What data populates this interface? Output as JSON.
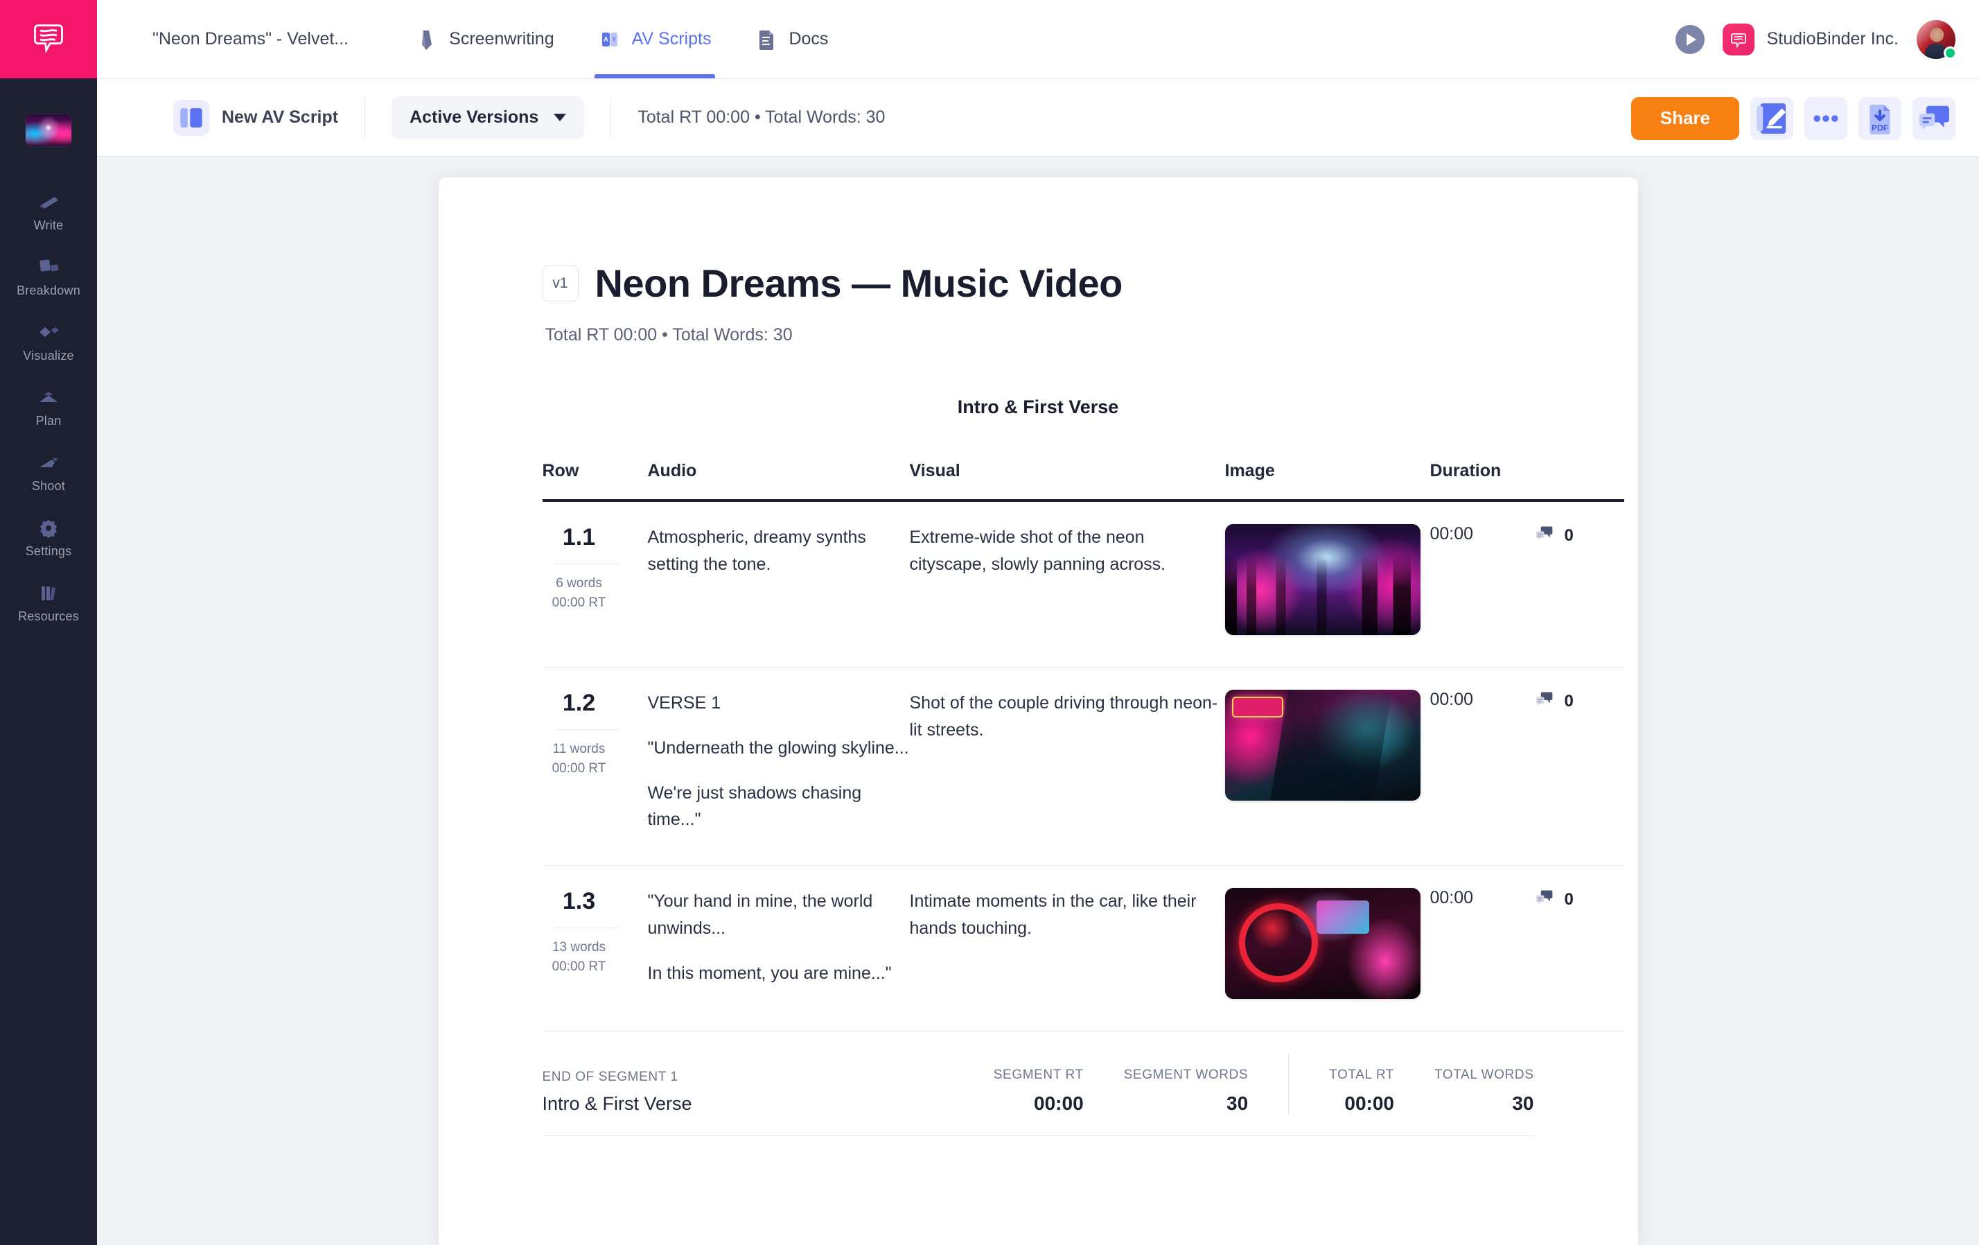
{
  "brand": {
    "logo_icon": "speech-bubble-logo",
    "accent_pink": "#f4166b",
    "accent_blue": "#5b72f2",
    "accent_orange": "#f98012",
    "rail_bg": "#1d2030"
  },
  "rail": {
    "project_thumb_name": "project-thumbnail",
    "items": [
      {
        "label": "Write",
        "icon": "pen-icon"
      },
      {
        "label": "Breakdown",
        "icon": "cards-icon"
      },
      {
        "label": "Visualize",
        "icon": "shapes-icon"
      },
      {
        "label": "Plan",
        "icon": "calendar-icon"
      },
      {
        "label": "Shoot",
        "icon": "clapper-icon"
      },
      {
        "label": "Settings",
        "icon": "gear-icon"
      },
      {
        "label": "Resources",
        "icon": "books-icon"
      }
    ]
  },
  "topbar": {
    "project_title": "\"Neon Dreams\" - Velvet...",
    "tabs": [
      {
        "label": "Screenwriting",
        "icon": "pen-nib-icon",
        "active": false
      },
      {
        "label": "AV Scripts",
        "icon": "av-icon",
        "active": true
      },
      {
        "label": "Docs",
        "icon": "document-icon",
        "active": false
      }
    ],
    "play_button": "play-icon",
    "org_name": "StudioBinder Inc.",
    "org_badge_icon": "studiobinder-logo",
    "avatar": "user-avatar",
    "status": "online"
  },
  "toolbar": {
    "new_script_label": "New AV Script",
    "new_script_icon": "panel-icon",
    "versions_label": "Active Versions",
    "versions_caret": "chevron-down-icon",
    "totals": "Total RT 00:00 • Total Words: 30",
    "share_label": "Share",
    "actions": [
      {
        "name": "notebook-edit-icon"
      },
      {
        "name": "more-options-icon"
      },
      {
        "name": "download-pdf-icon"
      },
      {
        "name": "comments-icon"
      }
    ]
  },
  "document": {
    "version_chip": "v1",
    "title": "Neon Dreams — Music Video",
    "subtitle": "Total RT 00:00 • Total Words: 30",
    "segment_title": "Intro & First Verse"
  },
  "table": {
    "headers": [
      "Row",
      "Audio",
      "Visual",
      "Image",
      "Duration"
    ],
    "rows": [
      {
        "number": "1.1",
        "words": "6 words",
        "rt": "00:00 RT",
        "audio": [
          "Atmospheric, dreamy synths setting the tone."
        ],
        "visual": "Extreme-wide shot of the neon cityscape, slowly panning across.",
        "image_alt": "neon-cityscape-thumbnail",
        "duration": "00:00",
        "comments": "0"
      },
      {
        "number": "1.2",
        "words": "11 words",
        "rt": "00:00 RT",
        "audio": [
          "VERSE 1",
          "\"Underneath the glowing skyline...",
          "We're just shadows chasing time...\""
        ],
        "visual": "Shot of the couple driving through neon-lit streets.",
        "image_alt": "couple-driving-thumbnail",
        "duration": "00:00",
        "comments": "0"
      },
      {
        "number": "1.3",
        "words": "13 words",
        "rt": "00:00 RT",
        "audio": [
          "\"Your hand in mine, the world unwinds...",
          "In this moment, you are mine...\""
        ],
        "visual": "Intimate moments in the car, like their hands touching.",
        "image_alt": "car-interior-hands-thumbnail",
        "duration": "00:00",
        "comments": "0"
      }
    ]
  },
  "summary": {
    "end_of_segment": "END OF SEGMENT 1",
    "segment_name": "Intro & First Verse",
    "stats": [
      {
        "key": "SEGMENT RT",
        "value": "00:00"
      },
      {
        "key": "SEGMENT WORDS",
        "value": "30"
      },
      {
        "key": "TOTAL RT",
        "value": "00:00"
      },
      {
        "key": "TOTAL WORDS",
        "value": "30"
      }
    ]
  }
}
